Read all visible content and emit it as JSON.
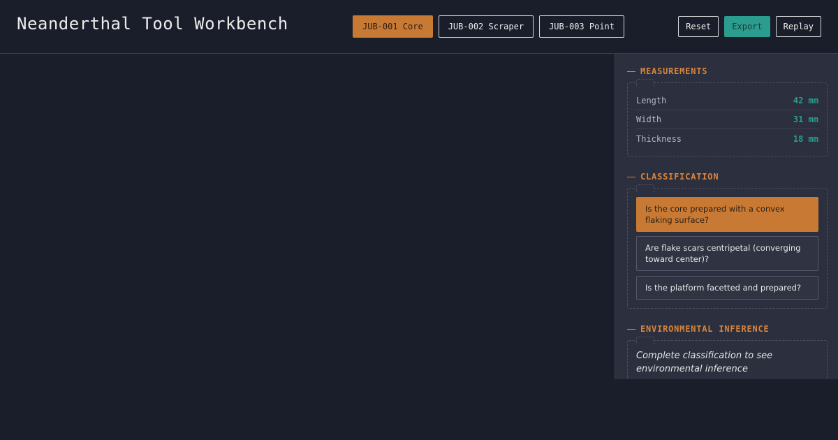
{
  "app": {
    "title": "Neanderthal Tool Workbench"
  },
  "specimens": [
    {
      "label": "JUB-001 Core",
      "active": true
    },
    {
      "label": "JUB-002 Scraper",
      "active": false
    },
    {
      "label": "JUB-003 Point",
      "active": false
    }
  ],
  "actions": {
    "reset": "Reset",
    "export": "Export",
    "replay": "Replay"
  },
  "measurements": {
    "heading": "MEASUREMENTS",
    "rows": [
      {
        "label": "Length",
        "value": "42 mm"
      },
      {
        "label": "Width",
        "value": "31 mm"
      },
      {
        "label": "Thickness",
        "value": "18 mm"
      }
    ]
  },
  "classification": {
    "heading": "CLASSIFICATION",
    "questions": [
      {
        "text": "Is the core prepared with a convex flaking surface?",
        "active": true
      },
      {
        "text": "Are flake scars centripetal (converging toward center)?",
        "active": false
      },
      {
        "text": "Is the platform facetted and prepared?",
        "active": false
      }
    ]
  },
  "environment": {
    "heading": "ENVIRONMENTAL INFERENCE",
    "placeholder": "Complete classification to see environmental inference"
  },
  "colors": {
    "accent": "#c87a35",
    "teal": "#2a9d8f",
    "background": "#1a1e2b",
    "panel": "#2b2f3e"
  }
}
